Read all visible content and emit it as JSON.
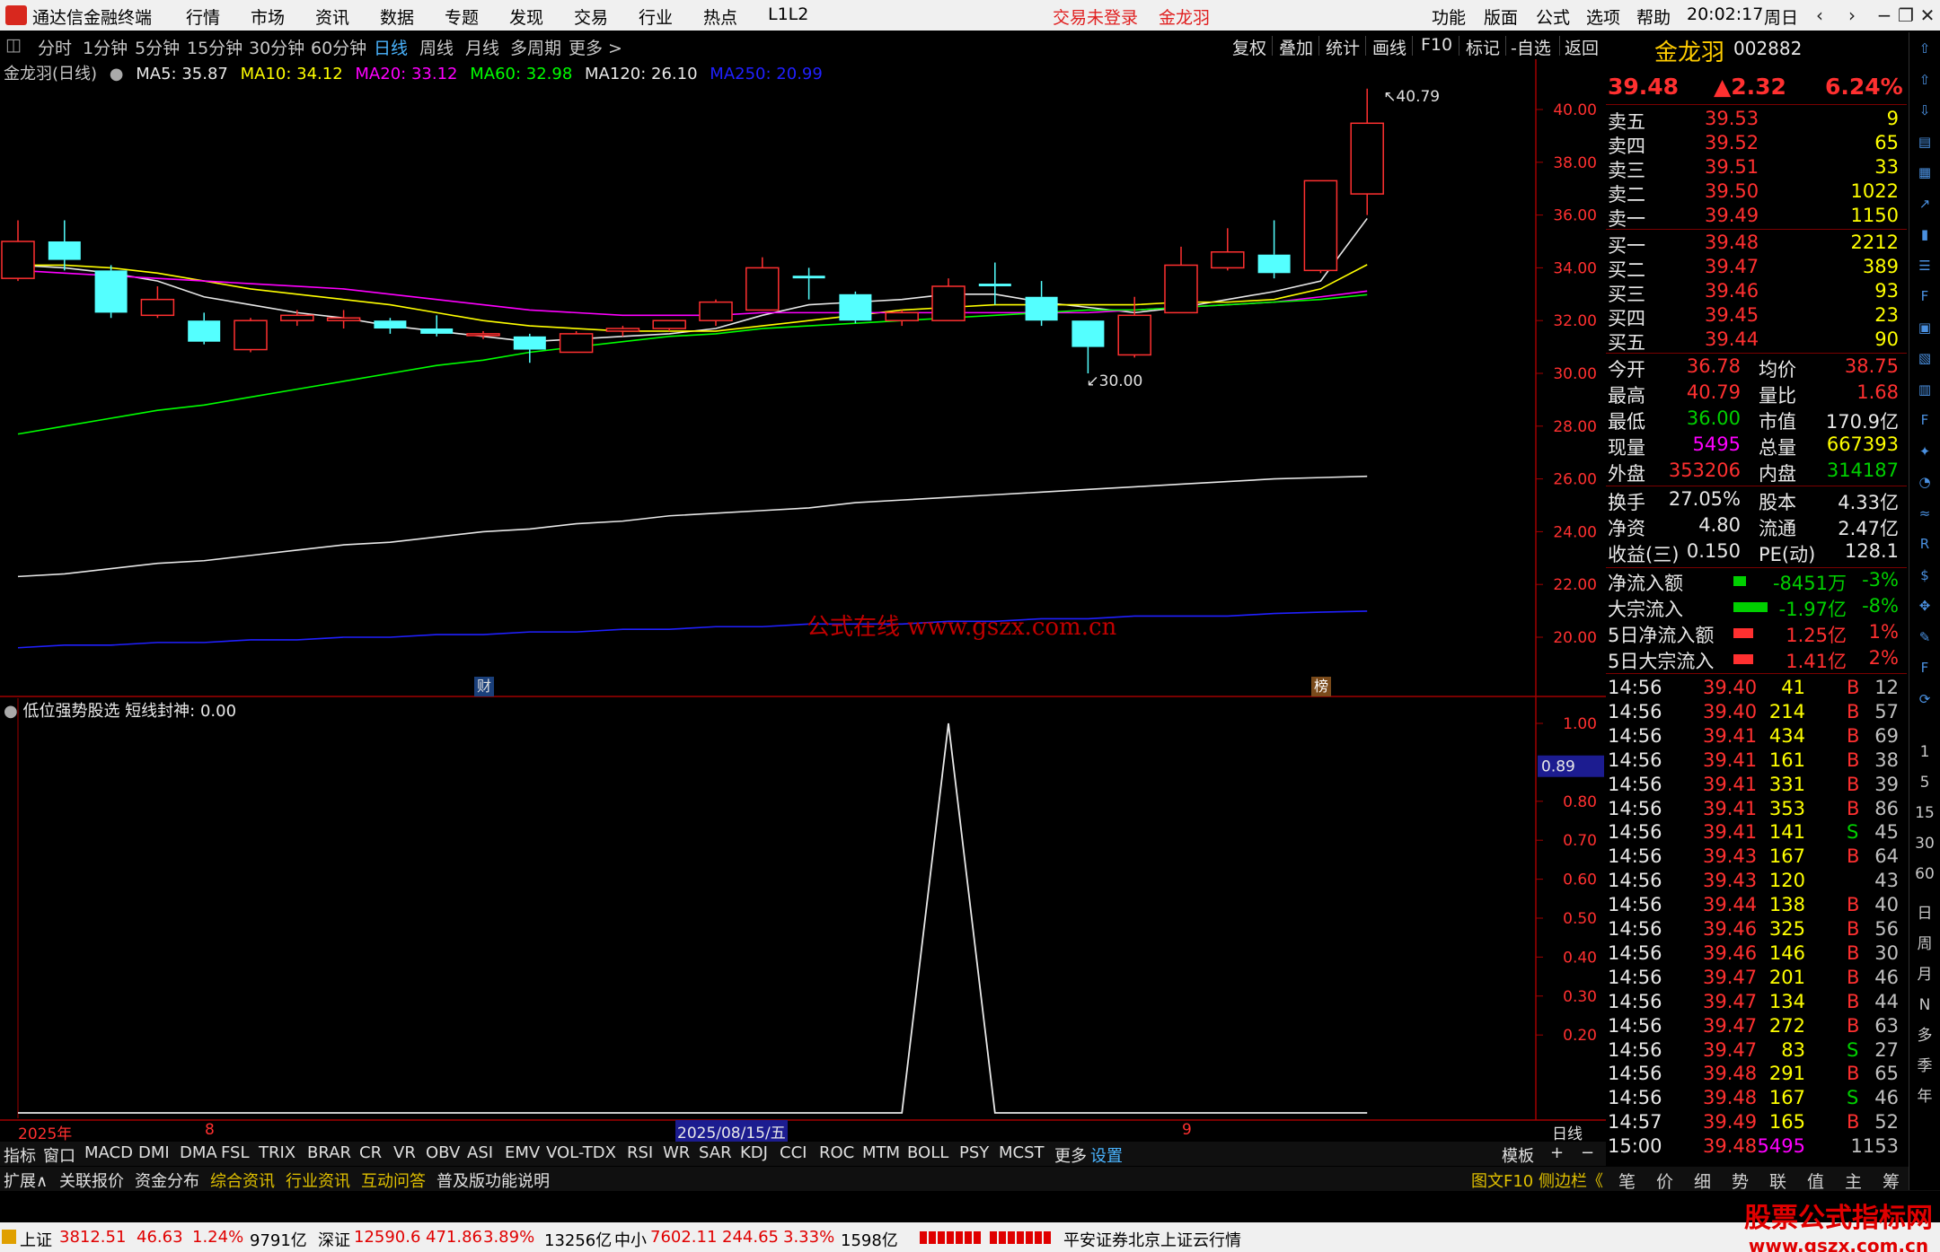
{
  "titlebar": {
    "app_name": "通达信金融终端",
    "menus": [
      "行情",
      "市场",
      "资讯",
      "数据",
      "专题",
      "发现",
      "交易",
      "行业",
      "热点",
      "L1L2"
    ],
    "login_status": "交易未登录",
    "current_stock": "金龙羽",
    "right_menus": [
      "功能",
      "版面",
      "公式",
      "选项",
      "帮助"
    ],
    "time": "20:02:17",
    "weekday": "周日"
  },
  "periods": [
    "分时",
    "1分钟",
    "5分钟",
    "15分钟",
    "30分钟",
    "60分钟",
    "日线",
    "周线",
    "月线",
    "多周期",
    "更多 >"
  ],
  "active_period": "日线",
  "chart_tools": [
    "复权",
    "叠加",
    "统计",
    "画线",
    "F10",
    "标记",
    "-自选",
    "返回"
  ],
  "main_chart": {
    "series_label": "金龙羽(日线)",
    "ma": [
      {
        "label": "MA5: 35.87",
        "color": "#e8e8e8"
      },
      {
        "label": "MA10: 34.12",
        "color": "#ffff00"
      },
      {
        "label": "MA20: 33.12",
        "color": "#ff00ff"
      },
      {
        "label": "MA60: 32.98",
        "color": "#00ff00"
      },
      {
        "label": "MA120: 26.10",
        "color": "#e8e8e8"
      },
      {
        "label": "MA250: 20.99",
        "color": "#2020ff"
      }
    ],
    "price_ticks": [
      "40.00",
      "38.00",
      "36.00",
      "34.00",
      "32.00",
      "30.00",
      "28.00",
      "26.00",
      "24.00",
      "22.00",
      "20.00"
    ],
    "high_label": "40.79",
    "low_label": "30.00",
    "watermark": "公式在线  www.gszx.com.cn",
    "marker_cai": "财",
    "marker_bang": "榜"
  },
  "chart_data": {
    "type": "candlestick",
    "ylim": [
      19.5,
      41.2
    ],
    "candles": [
      {
        "o": 33.6,
        "c": 35.0,
        "h": 35.8,
        "l": 33.5
      },
      {
        "o": 35.0,
        "c": 34.3,
        "h": 35.8,
        "l": 33.9
      },
      {
        "o": 33.9,
        "c": 32.3,
        "h": 34.1,
        "l": 32.1
      },
      {
        "o": 32.2,
        "c": 32.8,
        "h": 33.3,
        "l": 32.1
      },
      {
        "o": 32.0,
        "c": 31.2,
        "h": 32.3,
        "l": 31.1
      },
      {
        "o": 30.9,
        "c": 32.0,
        "h": 32.1,
        "l": 30.8
      },
      {
        "o": 32.0,
        "c": 32.2,
        "h": 32.4,
        "l": 31.8
      },
      {
        "o": 32.0,
        "c": 32.1,
        "h": 32.4,
        "l": 31.7
      },
      {
        "o": 32.0,
        "c": 31.7,
        "h": 32.1,
        "l": 31.5
      },
      {
        "o": 31.7,
        "c": 31.5,
        "h": 32.2,
        "l": 31.4
      },
      {
        "o": 31.5,
        "c": 31.5,
        "h": 31.6,
        "l": 31.3
      },
      {
        "o": 31.4,
        "c": 30.9,
        "h": 31.5,
        "l": 30.4
      },
      {
        "o": 30.8,
        "c": 31.5,
        "h": 31.6,
        "l": 30.8
      },
      {
        "o": 31.6,
        "c": 31.7,
        "h": 31.8,
        "l": 31.4
      },
      {
        "o": 31.7,
        "c": 32.0,
        "h": 32.0,
        "l": 31.6
      },
      {
        "o": 32.0,
        "c": 32.7,
        "h": 32.8,
        "l": 31.8
      },
      {
        "o": 32.4,
        "c": 34.0,
        "h": 34.4,
        "l": 32.4
      },
      {
        "o": 33.7,
        "c": 33.6,
        "h": 34.0,
        "l": 32.8
      },
      {
        "o": 33.0,
        "c": 32.0,
        "h": 33.1,
        "l": 31.9
      },
      {
        "o": 32.0,
        "c": 32.3,
        "h": 32.4,
        "l": 31.8
      },
      {
        "o": 32.0,
        "c": 33.3,
        "h": 33.6,
        "l": 32.0
      },
      {
        "o": 33.4,
        "c": 33.3,
        "h": 34.2,
        "l": 32.6
      },
      {
        "o": 32.9,
        "c": 32.0,
        "h": 33.5,
        "l": 31.8
      },
      {
        "o": 32.0,
        "c": 31.0,
        "h": 32.0,
        "l": 30.0
      },
      {
        "o": 30.7,
        "c": 32.2,
        "h": 32.9,
        "l": 30.6
      },
      {
        "o": 32.3,
        "c": 34.1,
        "h": 34.8,
        "l": 32.3
      },
      {
        "o": 34.0,
        "c": 34.6,
        "h": 35.5,
        "l": 33.9
      },
      {
        "o": 34.5,
        "c": 33.8,
        "h": 35.8,
        "l": 33.6
      },
      {
        "o": 33.9,
        "c": 37.3,
        "h": 37.3,
        "l": 33.8
      },
      {
        "o": 36.8,
        "c": 39.48,
        "h": 40.79,
        "l": 36.0
      }
    ],
    "ma5": [
      34.1,
      34.0,
      33.8,
      33.5,
      32.9,
      32.6,
      32.3,
      32.1,
      31.8,
      31.6,
      31.4,
      31.2,
      31.3,
      31.4,
      31.5,
      31.7,
      32.2,
      32.6,
      32.7,
      32.8,
      33.0,
      33.0,
      32.7,
      32.5,
      32.3,
      32.5,
      32.8,
      33.1,
      33.5,
      35.87
    ],
    "ma10": [
      34.1,
      34.1,
      34.0,
      33.8,
      33.5,
      33.2,
      33.0,
      32.8,
      32.6,
      32.3,
      32.0,
      31.8,
      31.7,
      31.6,
      31.6,
      31.6,
      31.8,
      32.0,
      32.2,
      32.4,
      32.5,
      32.6,
      32.6,
      32.6,
      32.6,
      32.7,
      32.7,
      32.8,
      33.2,
      34.12
    ],
    "ma20": [
      33.9,
      33.8,
      33.7,
      33.6,
      33.5,
      33.4,
      33.3,
      33.2,
      33.0,
      32.8,
      32.6,
      32.4,
      32.3,
      32.2,
      32.2,
      32.2,
      32.3,
      32.3,
      32.3,
      32.3,
      32.3,
      32.3,
      32.3,
      32.3,
      32.4,
      32.5,
      32.6,
      32.7,
      32.9,
      33.12
    ],
    "ma60": [
      27.7,
      28.0,
      28.3,
      28.6,
      28.8,
      29.1,
      29.4,
      29.7,
      30.0,
      30.3,
      30.5,
      30.8,
      31.0,
      31.2,
      31.4,
      31.5,
      31.7,
      31.8,
      31.9,
      32.0,
      32.1,
      32.2,
      32.3,
      32.4,
      32.4,
      32.5,
      32.6,
      32.7,
      32.8,
      32.98
    ],
    "ma120": [
      22.3,
      22.4,
      22.6,
      22.8,
      22.9,
      23.1,
      23.3,
      23.5,
      23.6,
      23.8,
      24.0,
      24.1,
      24.3,
      24.4,
      24.6,
      24.7,
      24.8,
      24.9,
      25.1,
      25.2,
      25.3,
      25.4,
      25.5,
      25.6,
      25.7,
      25.8,
      25.9,
      26.0,
      26.05,
      26.1
    ],
    "ma250": [
      19.6,
      19.7,
      19.7,
      19.8,
      19.8,
      19.9,
      19.9,
      20.0,
      20.0,
      20.1,
      20.1,
      20.2,
      20.2,
      20.3,
      20.3,
      20.4,
      20.4,
      20.5,
      20.5,
      20.5,
      20.6,
      20.6,
      20.7,
      20.7,
      20.8,
      20.8,
      20.8,
      20.9,
      20.95,
      20.99
    ],
    "indicator": {
      "name": "低位强势股选",
      "label": "短线封神: 0.00",
      "ticks": [
        "1.00",
        "0.80",
        "0.70",
        "0.60",
        "0.50",
        "0.40",
        "0.30",
        "0.20"
      ],
      "current_tag": "0.89",
      "ylim": [
        0,
        1.0
      ],
      "values": [
        0,
        0,
        0,
        0,
        0,
        0,
        0,
        0,
        0,
        0,
        0,
        0,
        0,
        0,
        0,
        0,
        0,
        0,
        0,
        0,
        1.0,
        0,
        0,
        0,
        0,
        0,
        0,
        0,
        0,
        0
      ]
    }
  },
  "date_axis": {
    "year": "2025年",
    "month_8": "8",
    "selected_date": "2025/08/15/五",
    "month_9": "9",
    "period_tag": "日线"
  },
  "indicator_tabs": [
    "指标",
    "窗口",
    "MACD",
    "DMI",
    "DMA",
    "FSL",
    "TRIX",
    "BRAR",
    "CR",
    "VR",
    "OBV",
    "ASI",
    "EMV",
    "VOL-TDX",
    "RSI",
    "WR",
    "SAR",
    "KDJ",
    "CCI",
    "ROC",
    "MTM",
    "BOLL",
    "PSY",
    "MCST",
    "更多",
    "设置"
  ],
  "indicator_right": [
    "模板",
    "+",
    "−"
  ],
  "ext_tabs": [
    "扩展∧",
    "关联报价",
    "资金分布",
    "综合资讯",
    "行业资讯",
    "互动问答",
    "普及版功能说明"
  ],
  "ext_right": "图文F10 侧边栏《",
  "right_tabs": [
    "笔",
    "价",
    "细",
    "势",
    "联",
    "值",
    "主",
    "筹"
  ],
  "quote": {
    "name": "金龙羽",
    "code": "002882",
    "price": "39.48",
    "change": "▲2.32",
    "pct": "6.24%",
    "asks": [
      {
        "label": "卖五",
        "price": "39.53",
        "vol": "9"
      },
      {
        "label": "卖四",
        "price": "39.52",
        "vol": "65"
      },
      {
        "label": "卖三",
        "price": "39.51",
        "vol": "33"
      },
      {
        "label": "卖二",
        "price": "39.50",
        "vol": "1022"
      },
      {
        "label": "卖一",
        "price": "39.49",
        "vol": "1150"
      }
    ],
    "bids": [
      {
        "label": "买一",
        "price": "39.48",
        "vol": "2212"
      },
      {
        "label": "买二",
        "price": "39.47",
        "vol": "389"
      },
      {
        "label": "买三",
        "price": "39.46",
        "vol": "93"
      },
      {
        "label": "买四",
        "price": "39.45",
        "vol": "23"
      },
      {
        "label": "买五",
        "price": "39.44",
        "vol": "90"
      }
    ],
    "stats": [
      {
        "l1": "今开",
        "v1": "36.78",
        "c1": "#ff3030",
        "l2": "均价",
        "v2": "38.75",
        "c2": "#ff3030"
      },
      {
        "l1": "最高",
        "v1": "40.79",
        "c1": "#ff3030",
        "l2": "量比",
        "v2": "1.68",
        "c2": "#ff3030"
      },
      {
        "l1": "最低",
        "v1": "36.00",
        "c1": "#00d000",
        "l2": "市值",
        "v2": "170.9亿",
        "c2": "#e8e8e8"
      },
      {
        "l1": "现量",
        "v1": "5495",
        "c1": "#ff00ff",
        "l2": "总量",
        "v2": "667393",
        "c2": "#ffff00"
      },
      {
        "l1": "外盘",
        "v1": "353206",
        "c1": "#ff3030",
        "l2": "内盘",
        "v2": "314187",
        "c2": "#00d000"
      }
    ],
    "stats2": [
      {
        "l1": "换手",
        "v1": "27.05%",
        "l2": "股本",
        "v2": "4.33亿"
      },
      {
        "l1": "净资",
        "v1": "4.80",
        "l2": "流通",
        "v2": "2.47亿"
      },
      {
        "l1": "收益(三)",
        "v1": "0.150",
        "l2": "PE(动)",
        "v2": "128.1"
      }
    ],
    "flows": [
      {
        "label": "净流入额",
        "value": "-8451万",
        "pct": "-3%",
        "color": "#00d000"
      },
      {
        "label": "大宗流入",
        "value": "-1.97亿",
        "pct": "-8%",
        "color": "#00d000"
      },
      {
        "label": "5日净流入额",
        "value": "1.25亿",
        "pct": "1%",
        "color": "#ff3030"
      },
      {
        "label": "5日大宗流入",
        "value": "1.41亿",
        "pct": "2%",
        "color": "#ff3030"
      }
    ],
    "ticks": [
      {
        "t": "14:56",
        "p": "39.40",
        "v": "41",
        "s": "B",
        "n": "12"
      },
      {
        "t": "14:56",
        "p": "39.40",
        "v": "214",
        "s": "B",
        "n": "57"
      },
      {
        "t": "14:56",
        "p": "39.41",
        "v": "434",
        "s": "B",
        "n": "69"
      },
      {
        "t": "14:56",
        "p": "39.41",
        "v": "161",
        "s": "B",
        "n": "38"
      },
      {
        "t": "14:56",
        "p": "39.41",
        "v": "331",
        "s": "B",
        "n": "39"
      },
      {
        "t": "14:56",
        "p": "39.41",
        "v": "353",
        "s": "B",
        "n": "86"
      },
      {
        "t": "14:56",
        "p": "39.41",
        "v": "141",
        "s": "S",
        "n": "45"
      },
      {
        "t": "14:56",
        "p": "39.43",
        "v": "167",
        "s": "B",
        "n": "64"
      },
      {
        "t": "14:56",
        "p": "39.43",
        "v": "120",
        "s": "",
        "n": "43"
      },
      {
        "t": "14:56",
        "p": "39.44",
        "v": "138",
        "s": "B",
        "n": "40"
      },
      {
        "t": "14:56",
        "p": "39.46",
        "v": "325",
        "s": "B",
        "n": "56"
      },
      {
        "t": "14:56",
        "p": "39.46",
        "v": "146",
        "s": "B",
        "n": "30"
      },
      {
        "t": "14:56",
        "p": "39.47",
        "v": "201",
        "s": "B",
        "n": "46"
      },
      {
        "t": "14:56",
        "p": "39.47",
        "v": "134",
        "s": "B",
        "n": "44"
      },
      {
        "t": "14:56",
        "p": "39.47",
        "v": "272",
        "s": "B",
        "n": "63"
      },
      {
        "t": "14:56",
        "p": "39.47",
        "v": "83",
        "s": "S",
        "n": "27"
      },
      {
        "t": "14:56",
        "p": "39.48",
        "v": "291",
        "s": "B",
        "n": "65"
      },
      {
        "t": "14:56",
        "p": "39.48",
        "v": "167",
        "s": "S",
        "n": "46"
      },
      {
        "t": "14:57",
        "p": "39.49",
        "v": "165",
        "s": "B",
        "n": "52"
      },
      {
        "t": "15:00",
        "p": "39.48",
        "v": "5495",
        "s": "",
        "n": "1153"
      }
    ]
  },
  "side_toolbar": {
    "text_items": [
      "1",
      "5",
      "15",
      "30",
      "60",
      "日",
      "周",
      "月",
      "N",
      "多",
      "季",
      "年"
    ]
  },
  "statusbar": {
    "sh_name": "上证",
    "sh_val": "3812.51",
    "sh_chg": "46.63",
    "sh_pct": "1.24%",
    "sh_amt": "9791亿",
    "sz_name": "深证",
    "sz_val": "12590.6",
    "sz_chg": "471.86",
    "sz_pct": "3.89%",
    "sz_amt": "13256亿",
    "zx_name": "中小",
    "zx_val": "7602.11",
    "zx_chg": "244.65",
    "zx_pct": "3.33%",
    "zx_amt": "1598亿",
    "broker": "平安证券北京上证云行情"
  },
  "watermark": {
    "line1": "股票公式指标网",
    "line2": "www.gszx.com.cn"
  }
}
